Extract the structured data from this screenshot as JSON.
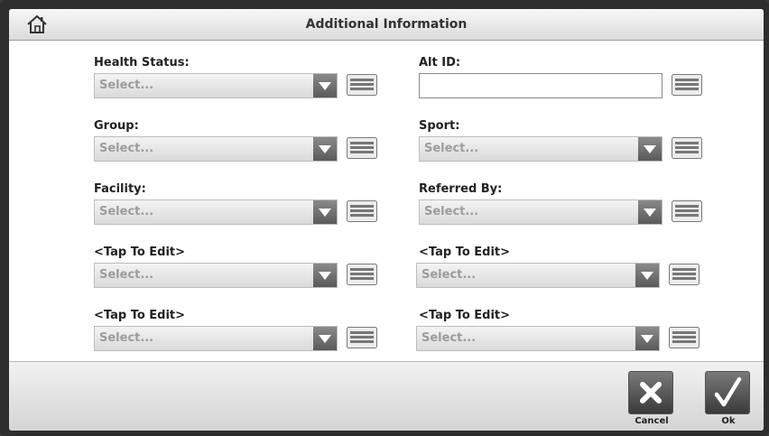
{
  "window": {
    "title": "Additional Information"
  },
  "fields": {
    "health_status": {
      "label": "Health Status:",
      "value": "Select..."
    },
    "alt_id": {
      "label": "Alt ID:",
      "value": ""
    },
    "group": {
      "label": "Group:",
      "value": "Select..."
    },
    "sport": {
      "label": "Sport:",
      "value": "Select..."
    },
    "facility": {
      "label": "Facility:",
      "value": "Select..."
    },
    "referred_by": {
      "label": "Referred By:",
      "value": "Select..."
    },
    "custom_1": {
      "label": "<Tap To Edit>",
      "value": "Select..."
    },
    "custom_2": {
      "label": "<Tap To Edit>",
      "value": "Select..."
    },
    "custom_3": {
      "label": "<Tap To Edit>",
      "value": "Select..."
    },
    "custom_4": {
      "label": "<Tap To Edit>",
      "value": "Select..."
    }
  },
  "footer": {
    "cancel_label": "Cancel",
    "ok_label": "Ok"
  },
  "icons": {
    "home": "home-icon",
    "dropdown": "triangle-down-icon",
    "keyboard": "keyboard-icon",
    "cancel": "x-icon",
    "ok": "checkmark-icon"
  }
}
